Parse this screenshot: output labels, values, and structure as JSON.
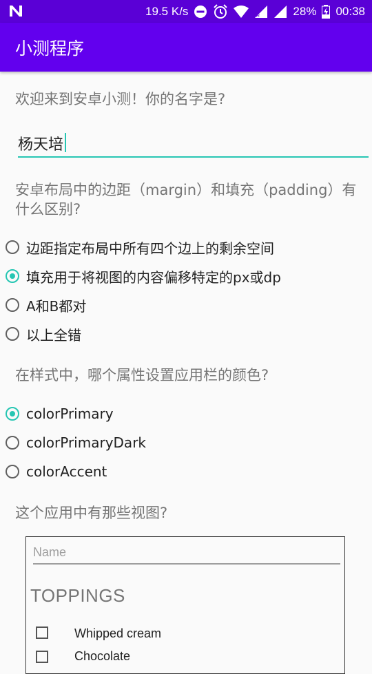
{
  "status_bar": {
    "network_speed": "19.5 K/s",
    "battery": "28%",
    "time": "00:38"
  },
  "app_bar": {
    "title": "小测程序"
  },
  "q1": {
    "text": "欢迎来到安卓小测！你的名字是?",
    "answer": "杨天培"
  },
  "q2": {
    "text": "安卓布局中的边距（margin）和填充（padding）有什么区别?",
    "options": [
      "边距指定布局中所有四个边上的剩余空间",
      "填充用于将视图的内容偏移特定的px或dp",
      "A和B都对",
      "以上全错"
    ],
    "selected": 1
  },
  "q3": {
    "text": "在样式中，哪个属性设置应用栏的颜色?",
    "options": [
      "colorPrimary",
      "colorPrimaryDark",
      "colorAccent"
    ],
    "selected": 0
  },
  "q4": {
    "text": "这个应用中有那些视图?",
    "image": {
      "name_placeholder": "Name",
      "heading": "TOPPINGS",
      "toppings": [
        "Whipped cream",
        "Chocolate"
      ]
    }
  },
  "colors": {
    "accent": "#26c6b3",
    "app_bar": "#6200ee",
    "status_bar": "#5a00d6"
  }
}
